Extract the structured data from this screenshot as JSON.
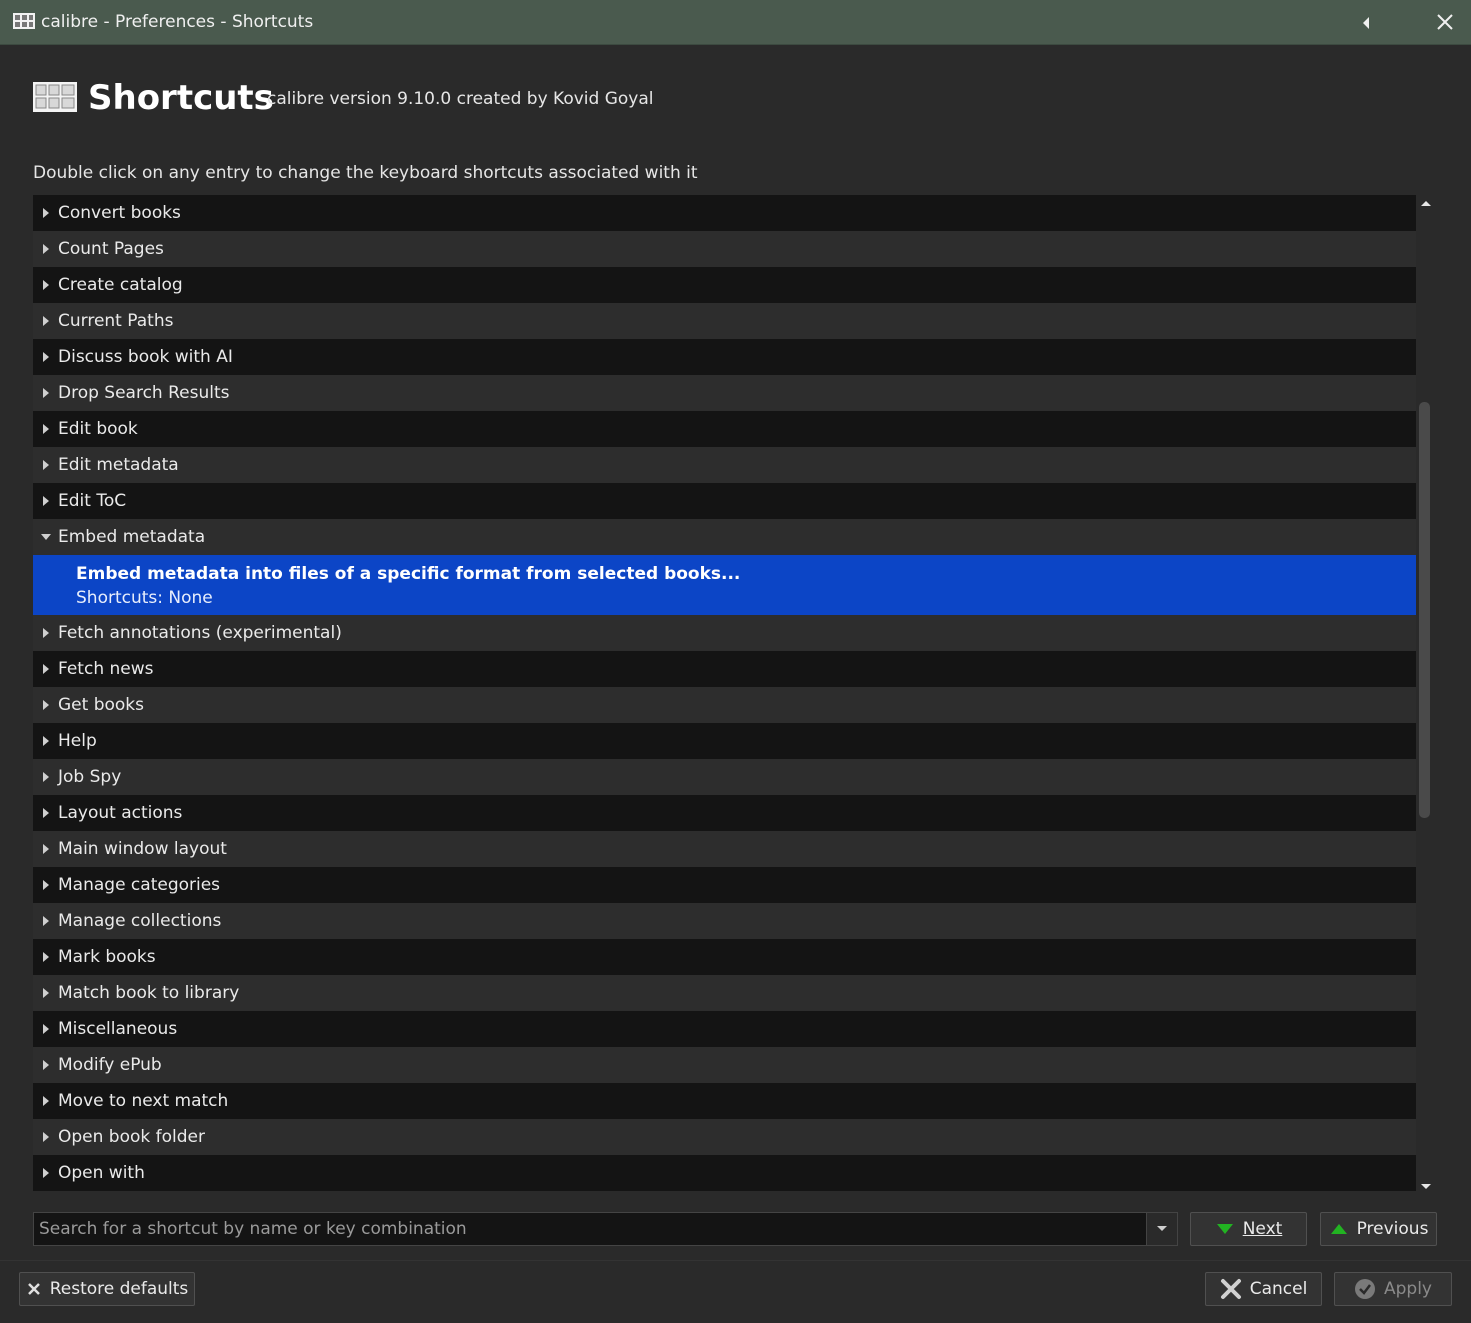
{
  "window": {
    "title": "calibre - Preferences - Shortcuts"
  },
  "header": {
    "title": "Shortcuts",
    "subtitle": "calibre version 9.10.0 created by Kovid Goyal"
  },
  "instructions": "Double click on any entry to change the keyboard shortcuts associated with it",
  "tree": {
    "groups_before": [
      {
        "label": "Convert books",
        "shade": "dark"
      },
      {
        "label": "Count Pages",
        "shade": "light"
      },
      {
        "label": "Create catalog",
        "shade": "dark"
      },
      {
        "label": "Current Paths",
        "shade": "light"
      },
      {
        "label": "Discuss book with AI",
        "shade": "dark"
      },
      {
        "label": "Drop Search Results",
        "shade": "light"
      },
      {
        "label": "Edit book",
        "shade": "dark"
      },
      {
        "label": "Edit metadata",
        "shade": "light"
      },
      {
        "label": "Edit ToC",
        "shade": "dark"
      }
    ],
    "expanded_group": {
      "label": "Embed metadata",
      "child": {
        "title": "Embed metadata into files of a specific format from selected books...",
        "shortcuts_label": "Shortcuts: None"
      }
    },
    "groups_after": [
      {
        "label": "Fetch annotations (experimental)",
        "shade": "light"
      },
      {
        "label": "Fetch news",
        "shade": "dark"
      },
      {
        "label": "Get books",
        "shade": "light"
      },
      {
        "label": "Help",
        "shade": "dark"
      },
      {
        "label": "Job Spy",
        "shade": "light"
      },
      {
        "label": "Layout actions",
        "shade": "dark"
      },
      {
        "label": "Main window layout",
        "shade": "light"
      },
      {
        "label": "Manage categories",
        "shade": "dark"
      },
      {
        "label": "Manage collections",
        "shade": "light"
      },
      {
        "label": "Mark books",
        "shade": "dark"
      },
      {
        "label": "Match book to library",
        "shade": "light"
      },
      {
        "label": "Miscellaneous",
        "shade": "dark"
      },
      {
        "label": "Modify ePub",
        "shade": "light"
      },
      {
        "label": "Move to next match",
        "shade": "dark"
      },
      {
        "label": "Open book folder",
        "shade": "light"
      },
      {
        "label": "Open with",
        "shade": "dark"
      }
    ]
  },
  "search": {
    "placeholder": "Search for a shortcut by name or key combination",
    "next_label": "Next",
    "previous_label": "Previous"
  },
  "footer": {
    "restore_label": "Restore defaults",
    "cancel_label": "Cancel",
    "apply_label": "Apply"
  },
  "colors": {
    "selection": "#0c45c6",
    "titlebar": "#4a5a4e",
    "next_arrow": "#22b322",
    "cancel_icon": "#d0d0d0"
  },
  "icons": {
    "app": "calibre-keyboard-icon",
    "back": "caret-left-icon",
    "close": "close-icon",
    "collapsed": "triangle-right-icon",
    "expanded": "triangle-down-icon",
    "next": "green-arrow-down-icon",
    "previous": "green-arrow-up-icon",
    "restore": "clear-icon",
    "cancel": "x-icon",
    "apply": "checkmark-icon"
  }
}
